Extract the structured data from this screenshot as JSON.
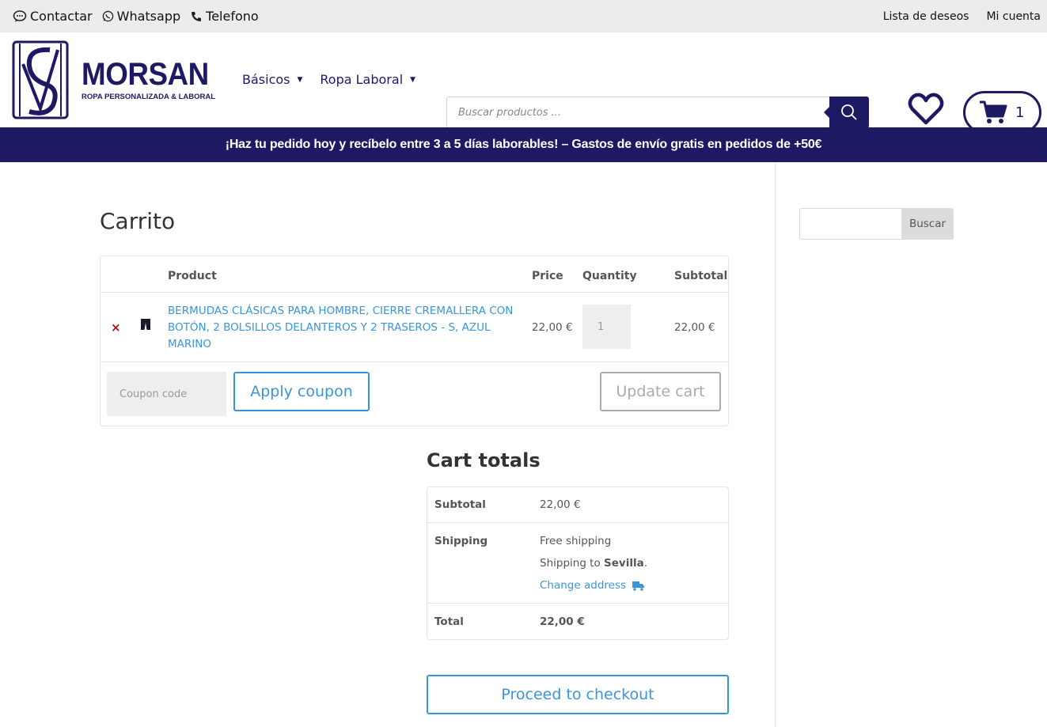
{
  "topbar": {
    "contact_label": "Contactar",
    "whatsapp_label": "Whatsapp",
    "phone_label": "Telefono",
    "wishlist_label": "Lista de deseos",
    "account_label": "Mi cuenta"
  },
  "brand": {
    "name": "MORSAN",
    "tagline": "ROPA PERSONALIZADA & LABORAL",
    "color": "#1d1a63"
  },
  "nav": {
    "items": [
      {
        "label": "Básicos"
      },
      {
        "label": "Ropa Laboral"
      }
    ]
  },
  "search": {
    "placeholder": "Buscar productos ..."
  },
  "header_cart": {
    "count": "1"
  },
  "banner": {
    "text": "¡Haz tu pedido hoy y recíbelo entre 3 a 5 días laborables! – Gastos de envío gratis en pedidos de +50€"
  },
  "cart": {
    "title": "Carrito",
    "columns": {
      "product": "Product",
      "price": "Price",
      "quantity": "Quantity",
      "subtotal": "Subtotal"
    },
    "items": [
      {
        "remove": "×",
        "name": "BERMUDAS CLÁSICAS PARA HOMBRE, CIERRE CREMALLERA CON BOTÓN, 2 BOLSILLOS DELANTEROS Y 2 TRASEROS - S, AZUL MARINO",
        "price": "22,00 €",
        "quantity": "1",
        "subtotal": "22,00 €"
      }
    ],
    "coupon_placeholder": "Coupon code",
    "apply_coupon_label": "Apply coupon",
    "update_cart_label": "Update cart"
  },
  "totals": {
    "title": "Cart totals",
    "subtotal_label": "Subtotal",
    "subtotal_value": "22,00 €",
    "shipping_label": "Shipping",
    "shipping_method": "Free shipping",
    "shipping_to_prefix": "Shipping to ",
    "shipping_city": "Sevilla",
    "shipping_to_suffix": ".",
    "change_address_label": "Change address",
    "total_label": "Total",
    "total_value": "22,00 €",
    "checkout_label": "Proceed to checkout"
  },
  "sidebar": {
    "search_button_label": "Buscar"
  },
  "colors": {
    "brand_navy": "#1d1a63",
    "link_blue": "#3a95d8",
    "remove_red": "#b01010"
  },
  "icons": [
    "chat-icon",
    "whatsapp-icon",
    "phone-icon",
    "search-icon",
    "heart-icon",
    "cart-icon",
    "truck-icon"
  ]
}
